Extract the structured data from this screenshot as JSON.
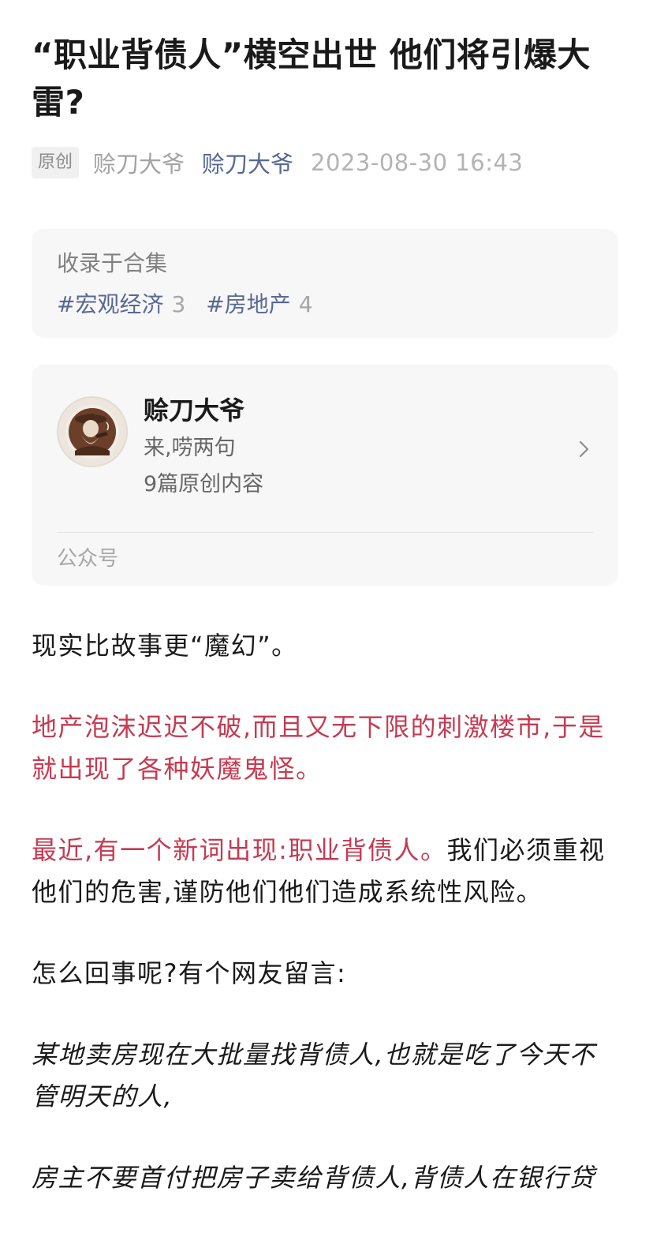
{
  "article": {
    "title": "“职业背债人”横空出世 他们将引爆大雷?",
    "original_tag": "原创",
    "author": "赊刀大爷",
    "account": "赊刀大爷",
    "publish_time": "2023-08-30 16:43"
  },
  "collection": {
    "title": "收录于合集",
    "tags": [
      {
        "name": "#宏观经济",
        "count": "3"
      },
      {
        "name": "#房地产",
        "count": "4"
      }
    ]
  },
  "profile": {
    "name": "赊刀大爷",
    "description": "来,唠两句",
    "post_count": "9篇原创内容",
    "footer": "公众号",
    "avatar_icon": "old-man-smoking-pipe-avatar"
  },
  "body": {
    "p1": "现实比故事更“魔幻”。",
    "p2": "地产泡沫迟迟不破,而且又无下限的刺激楼市,于是就出现了各种妖魔鬼怪。",
    "p3_red": "最近,有一个新词出现:职业背债人。",
    "p3_normal": "我们必须重视他们的危害,谨防他们他们造成系统性风险。",
    "p4": "怎么回事呢?有个网友留言:",
    "p5": "某地卖房现在大批量找背债人,也就是吃了今天不管明天的人,",
    "p6": "房主不要首付把房子卖给背债人,背债人在银行贷"
  },
  "colors": {
    "highlight_red": "#c53b52",
    "link_blue": "#586894",
    "card_bg": "#f7f7f7"
  }
}
